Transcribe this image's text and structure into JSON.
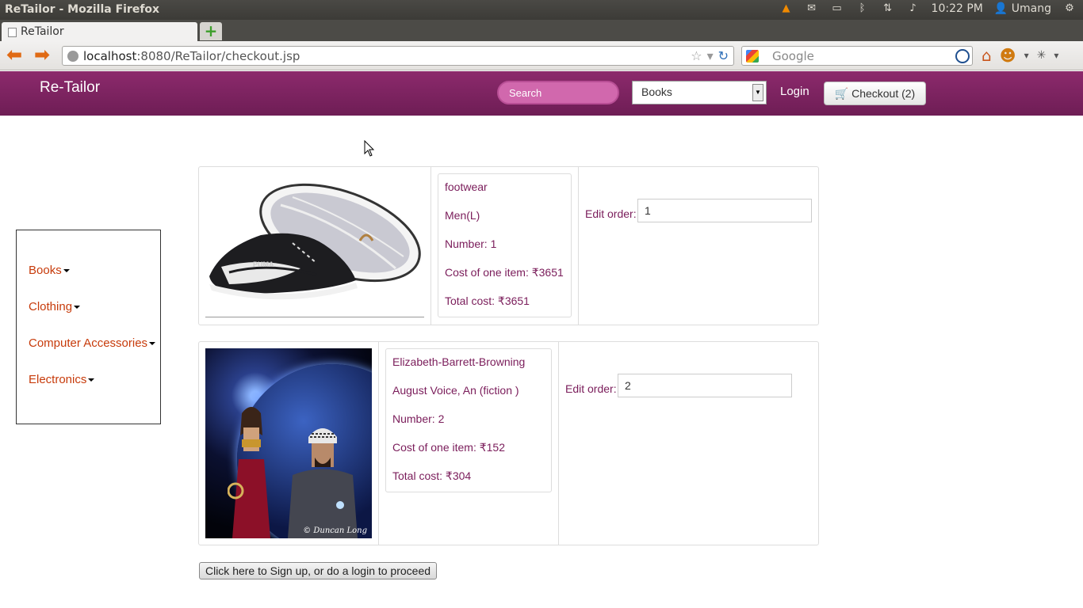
{
  "os": {
    "window_title": "ReTailor - Mozilla Firefox",
    "time": "10:22 PM",
    "user": "Umang"
  },
  "browser": {
    "tab_title": "ReTailor",
    "url_host": "localhost",
    "url_rest": ":8080/ReTailor/checkout.jsp",
    "search_placeholder": "Google"
  },
  "header": {
    "brand": "Re-Tailor",
    "search_placeholder": "Search",
    "category_select": "Books",
    "login_label": "Login",
    "checkout_label": "Checkout (2)"
  },
  "sidebar": {
    "items": [
      {
        "label": "Books"
      },
      {
        "label": "Clothing"
      },
      {
        "label": "Computer Accessories"
      },
      {
        "label": "Electronics"
      }
    ]
  },
  "orders": [
    {
      "line1": "footwear",
      "line2": "Men(L)",
      "number": "Number: 1",
      "cost_one": "Cost of one item: ₹3651",
      "total": "Total cost: ₹3651",
      "edit_label": "Edit order:",
      "edit_value": "1"
    },
    {
      "line1": "Elizabeth-Barrett-Browning",
      "line2": "August Voice, An (fiction )",
      "number": "Number: 2",
      "cost_one": "Cost of one item: ₹152",
      "total": "Total cost: ₹304",
      "edit_label": "Edit order:",
      "edit_value": "2",
      "image_credit": "© Duncan Long"
    }
  ],
  "proceed_label": "Click here to Sign up, or do a login to proceed",
  "colors": {
    "header_bg": "#7a2160",
    "link": "#c73b0b",
    "detail_text": "#7a1c5a"
  }
}
